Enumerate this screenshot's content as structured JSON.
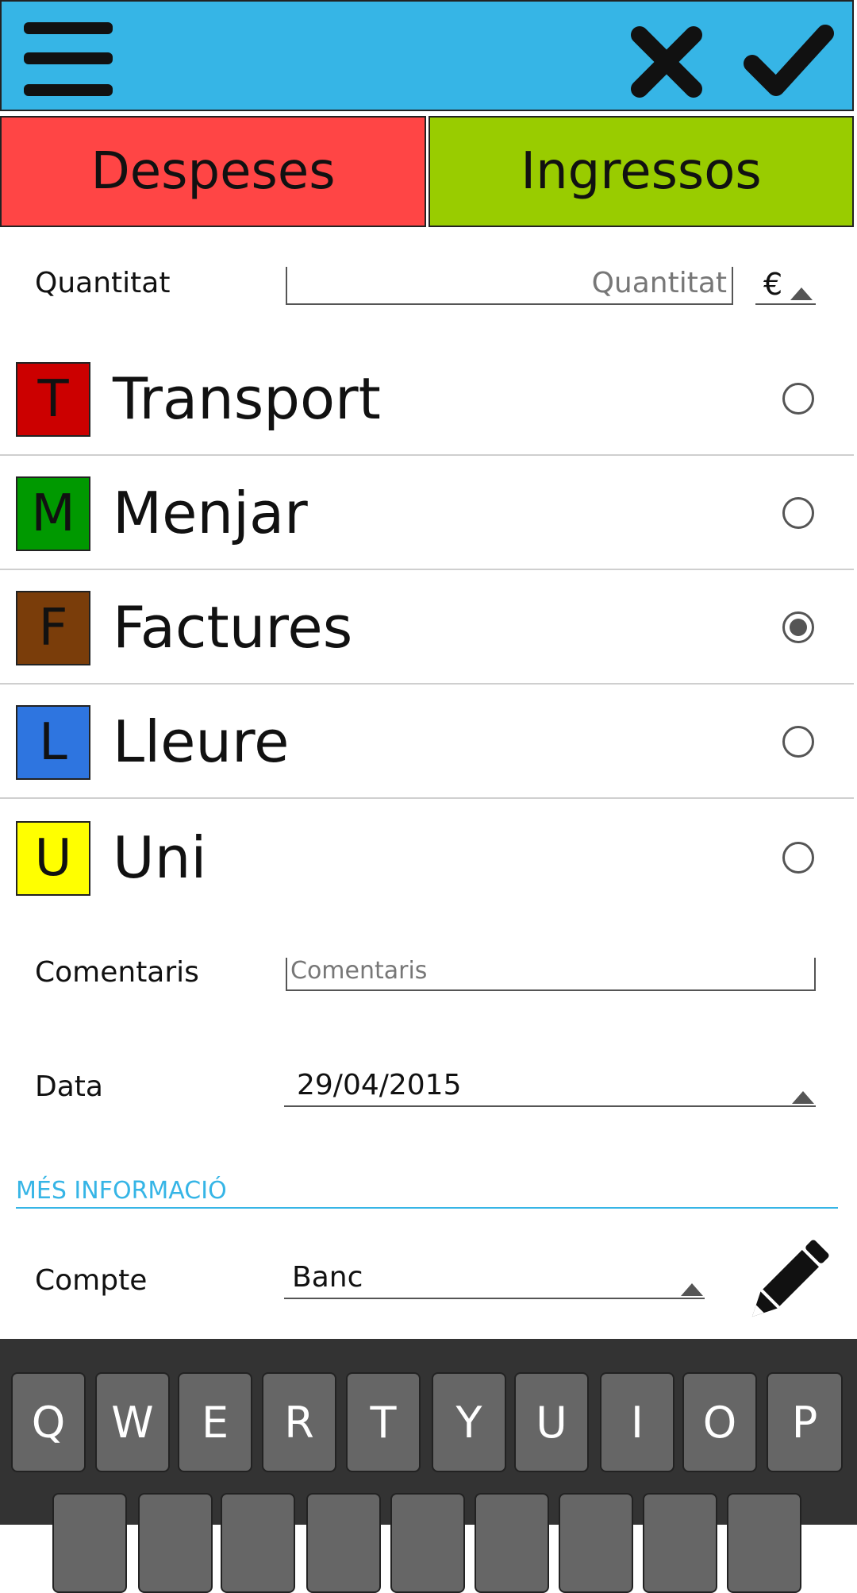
{
  "topbar": {
    "background": "#36b5e6",
    "menu_icon": "hamburger-icon",
    "cancel_icon": "close-icon",
    "confirm_icon": "check-icon"
  },
  "tabs": [
    {
      "label": "Despeses",
      "color": "#ff4545"
    },
    {
      "label": "Ingressos",
      "color": "#99cc00"
    }
  ],
  "amount": {
    "label": "Quantitat",
    "placeholder": "Quantitat",
    "value": "",
    "currency": "€"
  },
  "categories": [
    {
      "letter": "T",
      "label": "Transport",
      "color": "#cc0000",
      "selected": false
    },
    {
      "letter": "M",
      "label": "Menjar",
      "color": "#009900",
      "selected": false
    },
    {
      "letter": "F",
      "label": "Factures",
      "color": "#7a3d0a",
      "selected": true
    },
    {
      "letter": "L",
      "label": "Lleure",
      "color": "#2e75e0",
      "selected": false
    },
    {
      "letter": "U",
      "label": "Uni",
      "color": "#ffff00",
      "selected": false
    }
  ],
  "comments": {
    "label": "Comentaris",
    "placeholder": "Comentaris",
    "value": ""
  },
  "date": {
    "label": "Data",
    "value": "29/04/2015"
  },
  "more_info": {
    "title": "MÉS INFORMACIÓ"
  },
  "account": {
    "label": "Compte",
    "value": "Banc",
    "edit_icon": "pencil-icon"
  },
  "keyboard": {
    "row1": [
      "Q",
      "W",
      "E",
      "R",
      "T",
      "Y",
      "U",
      "I",
      "O",
      "P"
    ]
  }
}
